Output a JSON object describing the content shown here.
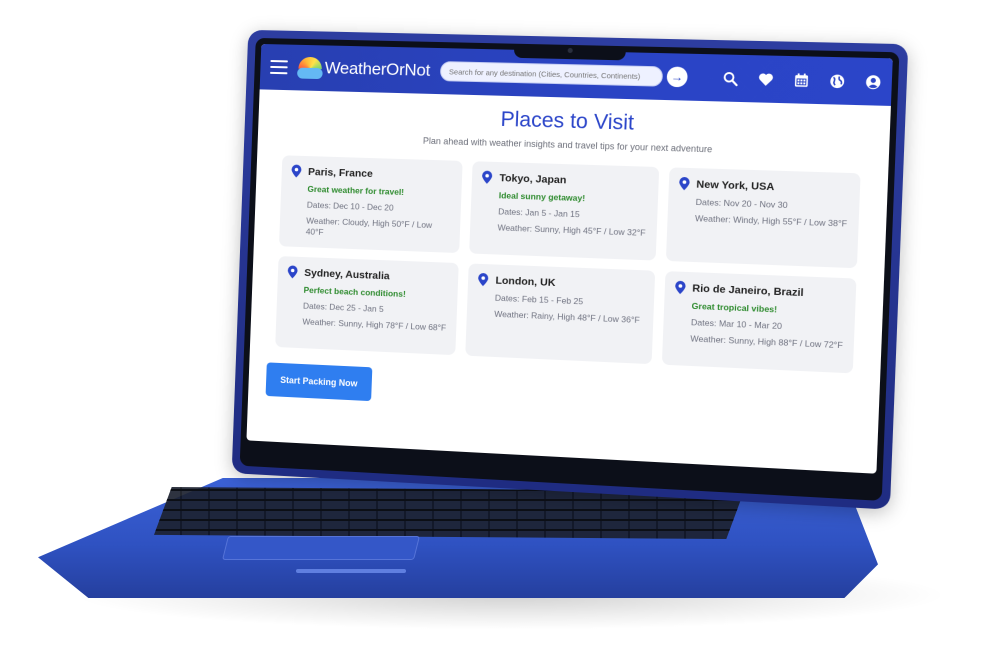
{
  "app": {
    "name": "WeatherOrNot"
  },
  "navbar": {
    "search_placeholder": "Search for any destination (Cities, Countries, Continents)",
    "icons": [
      "menu-icon",
      "search-icon",
      "heart-icon",
      "calendar-icon",
      "globe-icon",
      "user-icon"
    ]
  },
  "page": {
    "title": "Places to Visit",
    "subtitle": "Plan ahead with weather insights and travel tips for your next adventure"
  },
  "places": [
    {
      "name": "Paris, France",
      "tag": "Great weather for travel!",
      "dates": "Dates: Dec 10 - Dec 20",
      "weather": "Weather: Cloudy, High 50°F / Low 40°F"
    },
    {
      "name": "Tokyo, Japan",
      "tag": "Ideal sunny getaway!",
      "dates": "Dates: Jan 5 - Jan 15",
      "weather": "Weather: Sunny, High 45°F / Low 32°F"
    },
    {
      "name": "New York, USA",
      "tag": "",
      "dates": "Dates: Nov 20 - Nov 30",
      "weather": "Weather: Windy, High 55°F / Low 38°F"
    },
    {
      "name": "Sydney, Australia",
      "tag": "Perfect beach conditions!",
      "dates": "Dates: Dec 25 - Jan 5",
      "weather": "Weather: Sunny, High 78°F / Low 68°F"
    },
    {
      "name": "London, UK",
      "tag": "",
      "dates": "Dates: Feb 15 - Feb 25",
      "weather": "Weather: Rainy, High 48°F / Low 36°F"
    },
    {
      "name": "Rio de Janeiro, Brazil",
      "tag": "Great tropical vibes!",
      "dates": "Dates: Mar 10 - Mar 20",
      "weather": "Weather: Sunny, High 88°F / Low 72°F"
    }
  ],
  "cta": {
    "label": "Start Packing Now"
  },
  "colors": {
    "brand": "#2b45c9",
    "accent_button": "#2f7ef0",
    "tag_green": "#2e8b2e",
    "card_bg": "#f1f2f5",
    "laptop_body": "#2f52c2"
  }
}
